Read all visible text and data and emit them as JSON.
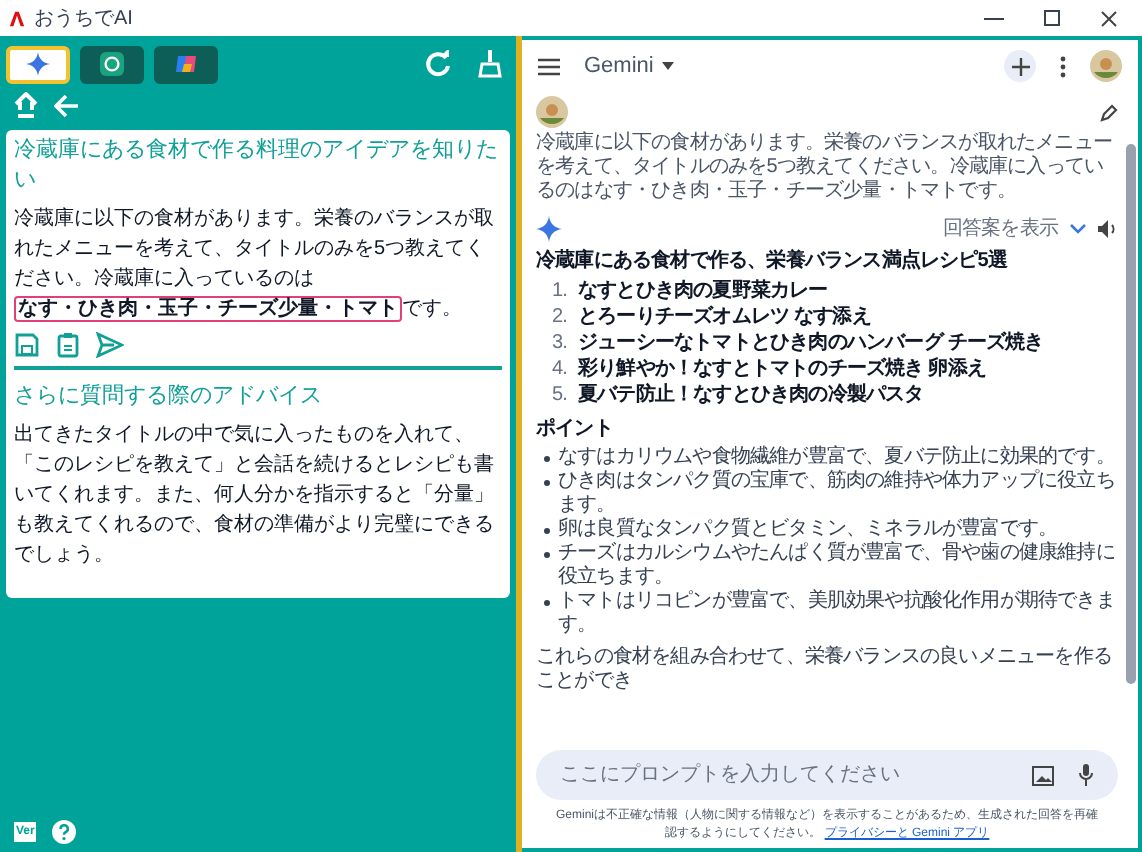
{
  "window": {
    "title": "おうちでAI"
  },
  "left_panel": {
    "tabs": [
      {
        "kind": "gemini",
        "selected": true
      },
      {
        "kind": "chatgpt",
        "selected": false
      },
      {
        "kind": "copilot",
        "selected": false
      }
    ],
    "prompt_card": {
      "heading": "冷蔵庫にある食材で作る料理のアイデアを知りたい",
      "text_before": "冷蔵庫に以下の食材があります。栄養のバランスが取れたメニューを考えて、タイトルのみを5つ教えてください。冷蔵庫に入っているのは",
      "highlight": "なす・ひき肉・玉子・チーズ少量・トマト",
      "text_after": "です。"
    },
    "advice_card": {
      "heading": "さらに質問する際のアドバイス",
      "text": "出てきたタイトルの中で気に入ったものを入れて、「このレシピを教えて」と会話を続けるとレシピも書いてくれます。また、何人分かを指示すると「分量」も教えてくれるので、食材の準備がより完璧にできるでしょう。"
    },
    "version_badge": "Ver"
  },
  "right_panel": {
    "app_title": "Gemini",
    "user_message": "冷蔵庫に以下の食材があります。栄養のバランスが取れたメニューを考えて、タイトルのみを5つ教えてください。冷蔵庫に入っているのはなす・ひき肉・玉子・チーズ少量・トマトです。",
    "show_drafts": "回答案を表示",
    "response": {
      "heading": "冷蔵庫にある食材で作る、栄養バランス満点レシピ5選",
      "recipes": [
        {
          "number": "1.",
          "title": "なすとひき肉の夏野菜カレー"
        },
        {
          "number": "2.",
          "title": "とろーりチーズオムレツ なす添え"
        },
        {
          "number": "3.",
          "title": "ジューシーなトマトとひき肉のハンバーグ チーズ焼き"
        },
        {
          "number": "4.",
          "title": "彩り鮮やか！なすとトマトのチーズ焼き 卵添え"
        },
        {
          "number": "5.",
          "title": "夏バテ防止！なすとひき肉の冷製パスタ"
        }
      ],
      "points_heading": "ポイント",
      "points": [
        "なすはカリウムや食物繊維が豊富で、夏バテ防止に効果的です。",
        "ひき肉はタンパク質の宝庫で、筋肉の維持や体力アップに役立ちます。",
        "卵は良質なタンパク質とビタミン、ミネラルが豊富です。",
        "チーズはカルシウムやたんぱく質が豊富で、骨や歯の健康維持に役立ちます。",
        "トマトはリコピンが豊富で、美肌効果や抗酸化作用が期待できます。"
      ],
      "closing": "これらの食材を組み合わせて、栄養バランスの良いメニューを作ることができ"
    },
    "prompt_input": {
      "placeholder": "ここにプロンプトを入力してください"
    },
    "disclaimer": "Geminiは不正確な情報（人物に関する情報など）を表示することがあるため、生成された回答を再確認するようにしてください。",
    "privacy_link": "プライバシーと Gemini アプリ"
  }
}
